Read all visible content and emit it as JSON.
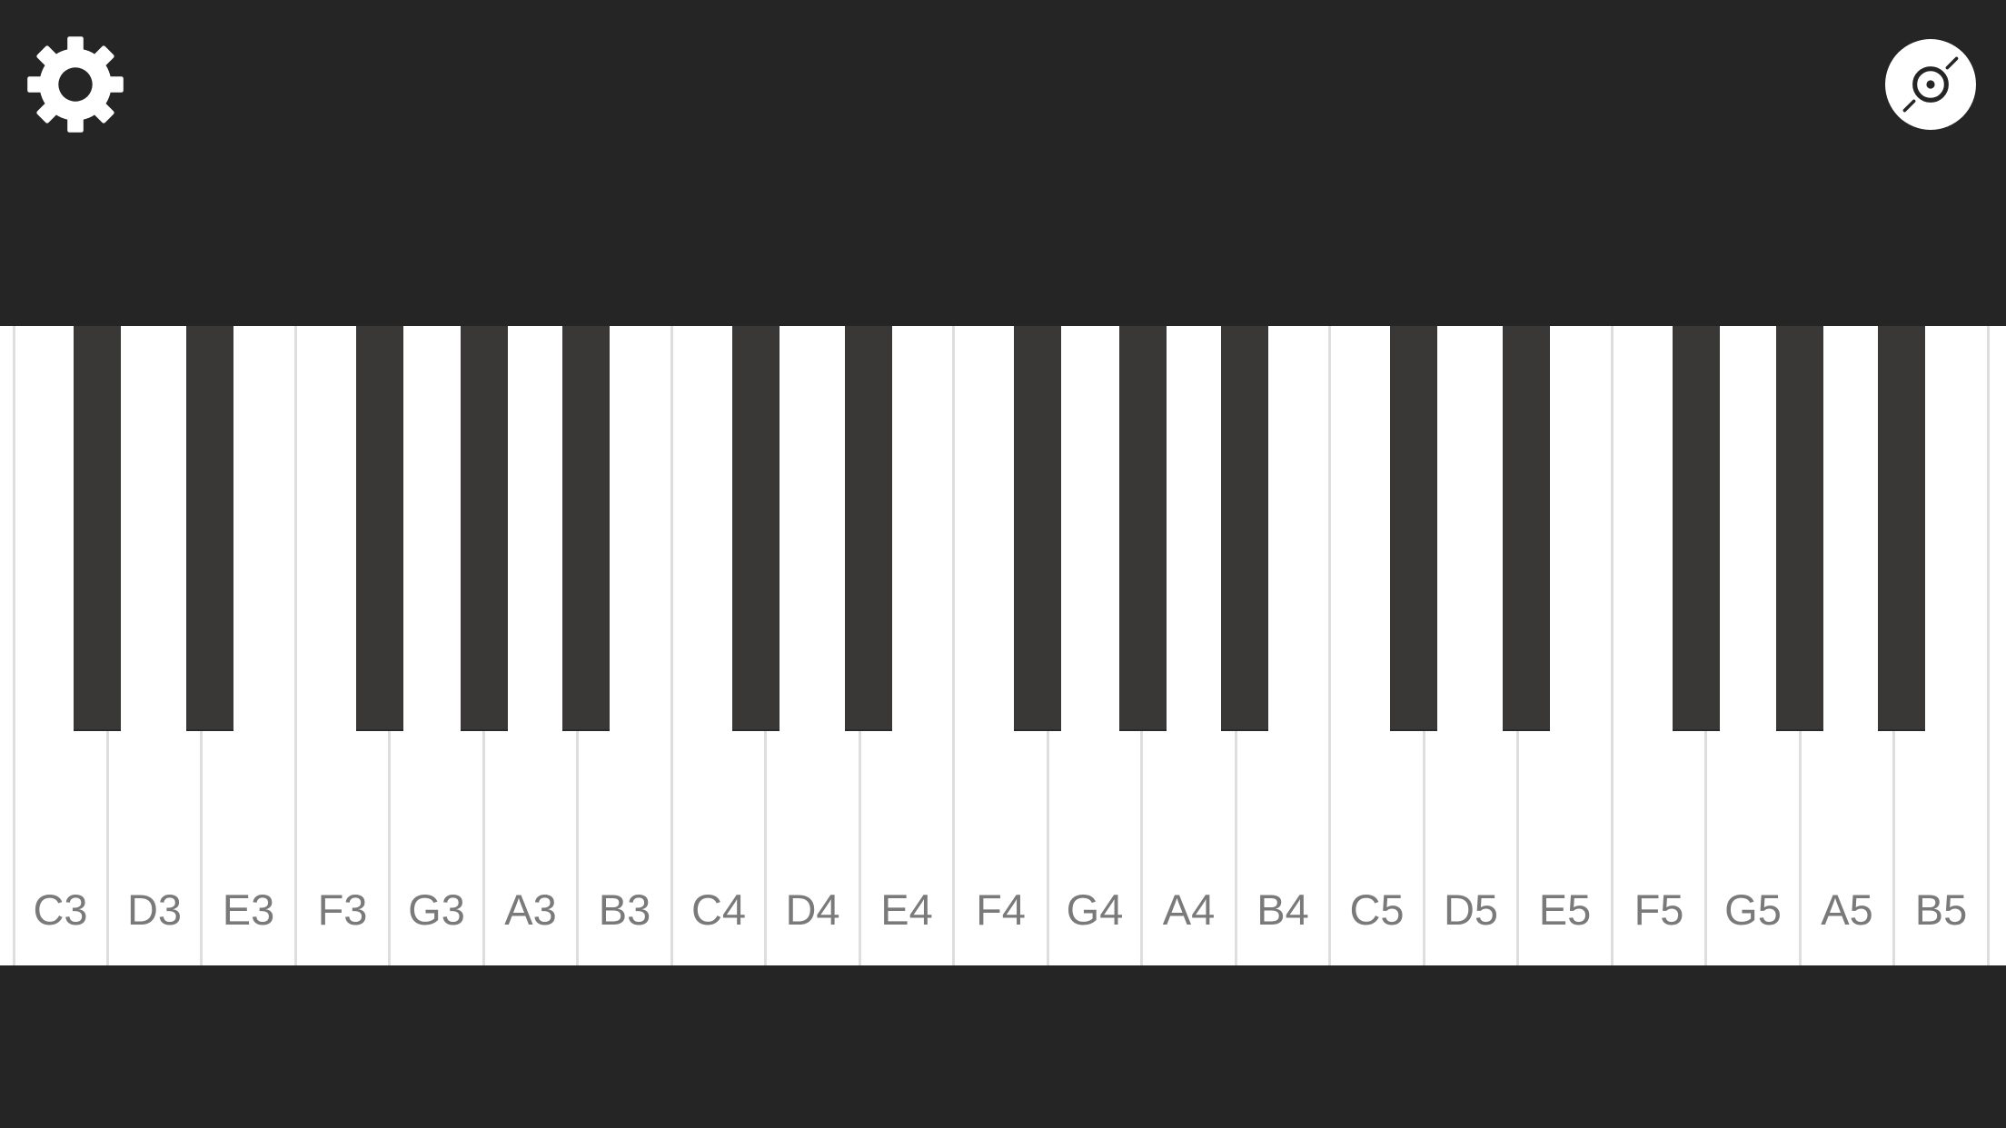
{
  "icons": {
    "settings": "gear-icon",
    "record": "vinyl-record-icon"
  },
  "colors": {
    "background": "#252525",
    "white_key": "#ffffff",
    "black_key": "#393837",
    "key_divider": "#dedede",
    "label_text": "#7a7a7a",
    "icon_fill": "#ffffff"
  },
  "keyboard": {
    "white_keys": [
      {
        "note": "C3"
      },
      {
        "note": "D3"
      },
      {
        "note": "E3"
      },
      {
        "note": "F3"
      },
      {
        "note": "G3"
      },
      {
        "note": "A3"
      },
      {
        "note": "B3"
      },
      {
        "note": "C4"
      },
      {
        "note": "D4"
      },
      {
        "note": "E4"
      },
      {
        "note": "F4"
      },
      {
        "note": "G4"
      },
      {
        "note": "A4"
      },
      {
        "note": "B4"
      },
      {
        "note": "C5"
      },
      {
        "note": "D5"
      },
      {
        "note": "E5"
      },
      {
        "note": "F5"
      },
      {
        "note": "G5"
      },
      {
        "note": "A5"
      },
      {
        "note": "B5"
      }
    ]
  }
}
